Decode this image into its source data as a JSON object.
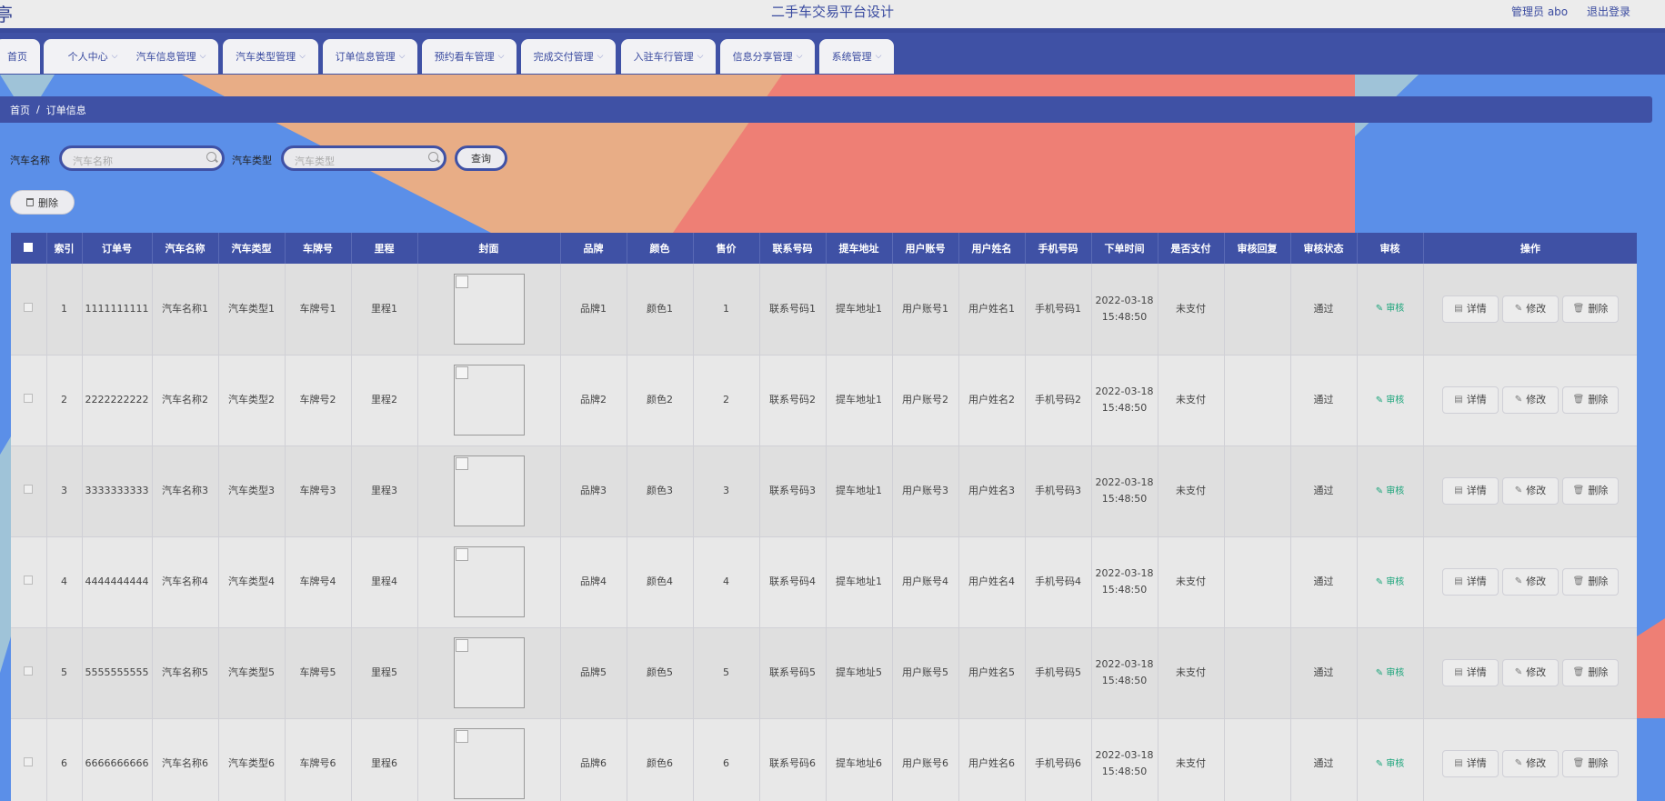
{
  "header": {
    "logo_glyph": "亭",
    "title": "二手车交易平台设计",
    "user": "管理员 abo",
    "logout": "退出登录"
  },
  "nav": [
    {
      "label": "首页",
      "has_menu": false
    },
    {
      "label": "个人中心",
      "has_menu": true
    },
    {
      "label": "汽车信息管理",
      "has_menu": true
    },
    {
      "label": "汽车类型管理",
      "has_menu": true
    },
    {
      "label": "订单信息管理",
      "has_menu": true
    },
    {
      "label": "预约看车管理",
      "has_menu": true
    },
    {
      "label": "完成交付管理",
      "has_menu": true
    },
    {
      "label": "入驻车行管理",
      "has_menu": true
    },
    {
      "label": "信息分享管理",
      "has_menu": true
    },
    {
      "label": "系统管理",
      "has_menu": true
    }
  ],
  "breadcrumb": {
    "home": "首页",
    "separator": "/",
    "current": "订单信息"
  },
  "search": {
    "car_name_label": "汽车名称",
    "car_name_placeholder": "汽车名称",
    "car_type_label": "汽车类型",
    "car_type_placeholder": "汽车类型",
    "query_button": "查询"
  },
  "toolbar": {
    "delete_button": "删除"
  },
  "table": {
    "columns": [
      "",
      "索引",
      "订单号",
      "汽车名称",
      "汽车类型",
      "车牌号",
      "里程",
      "封面",
      "品牌",
      "颜色",
      "售价",
      "联系号码",
      "提车地址",
      "用户账号",
      "用户姓名",
      "手机号码",
      "下单时间",
      "是否支付",
      "审核回复",
      "审核状态",
      "审核",
      "操作"
    ],
    "actions": {
      "audit": "审核",
      "detail": "详情",
      "edit": "修改",
      "delete": "删除"
    },
    "rows": [
      {
        "index": "1",
        "order_no": "1111111111",
        "car_name": "汽车名称1",
        "car_type": "汽车类型1",
        "plate": "车牌号1",
        "mileage": "里程1",
        "brand": "品牌1",
        "color": "颜色1",
        "price": "1",
        "contact": "联系号码1",
        "pickup": "提车地址1",
        "account": "用户账号1",
        "user_name": "用户姓名1",
        "phone": "手机号码1",
        "order_time": "2022-03-18 15:48:50",
        "paid": "未支付",
        "reply": "",
        "status": "通过"
      },
      {
        "index": "2",
        "order_no": "2222222222",
        "car_name": "汽车名称2",
        "car_type": "汽车类型2",
        "plate": "车牌号2",
        "mileage": "里程2",
        "brand": "品牌2",
        "color": "颜色2",
        "price": "2",
        "contact": "联系号码2",
        "pickup": "提车地址1",
        "account": "用户账号2",
        "user_name": "用户姓名2",
        "phone": "手机号码2",
        "order_time": "2022-03-18 15:48:50",
        "paid": "未支付",
        "reply": "",
        "status": "通过"
      },
      {
        "index": "3",
        "order_no": "3333333333",
        "car_name": "汽车名称3",
        "car_type": "汽车类型3",
        "plate": "车牌号3",
        "mileage": "里程3",
        "brand": "品牌3",
        "color": "颜色3",
        "price": "3",
        "contact": "联系号码3",
        "pickup": "提车地址1",
        "account": "用户账号3",
        "user_name": "用户姓名3",
        "phone": "手机号码3",
        "order_time": "2022-03-18 15:48:50",
        "paid": "未支付",
        "reply": "",
        "status": "通过"
      },
      {
        "index": "4",
        "order_no": "4444444444",
        "car_name": "汽车名称4",
        "car_type": "汽车类型4",
        "plate": "车牌号4",
        "mileage": "里程4",
        "brand": "品牌4",
        "color": "颜色4",
        "price": "4",
        "contact": "联系号码4",
        "pickup": "提车地址1",
        "account": "用户账号4",
        "user_name": "用户姓名4",
        "phone": "手机号码4",
        "order_time": "2022-03-18 15:48:50",
        "paid": "未支付",
        "reply": "",
        "status": "通过"
      },
      {
        "index": "5",
        "order_no": "5555555555",
        "car_name": "汽车名称5",
        "car_type": "汽车类型5",
        "plate": "车牌号5",
        "mileage": "里程5",
        "brand": "品牌5",
        "color": "颜色5",
        "price": "5",
        "contact": "联系号码5",
        "pickup": "提车地址5",
        "account": "用户账号5",
        "user_name": "用户姓名5",
        "phone": "手机号码5",
        "order_time": "2022-03-18 15:48:50",
        "paid": "未支付",
        "reply": "",
        "status": "通过"
      },
      {
        "index": "6",
        "order_no": "6666666666",
        "car_name": "汽车名称6",
        "car_type": "汽车类型6",
        "plate": "车牌号6",
        "mileage": "里程6",
        "brand": "品牌6",
        "color": "颜色6",
        "price": "6",
        "contact": "联系号码6",
        "pickup": "提车地址6",
        "account": "用户账号6",
        "user_name": "用户姓名6",
        "phone": "手机号码6",
        "order_time": "2022-03-18 15:48:50",
        "paid": "未支付",
        "reply": "",
        "status": "通过"
      }
    ]
  },
  "colors": {
    "primary": "#3f51a5",
    "background": "#5b8fe8",
    "accent_orange": "#e8ad86",
    "accent_red": "#ee7f75",
    "audit_green": "#1aa47a"
  }
}
